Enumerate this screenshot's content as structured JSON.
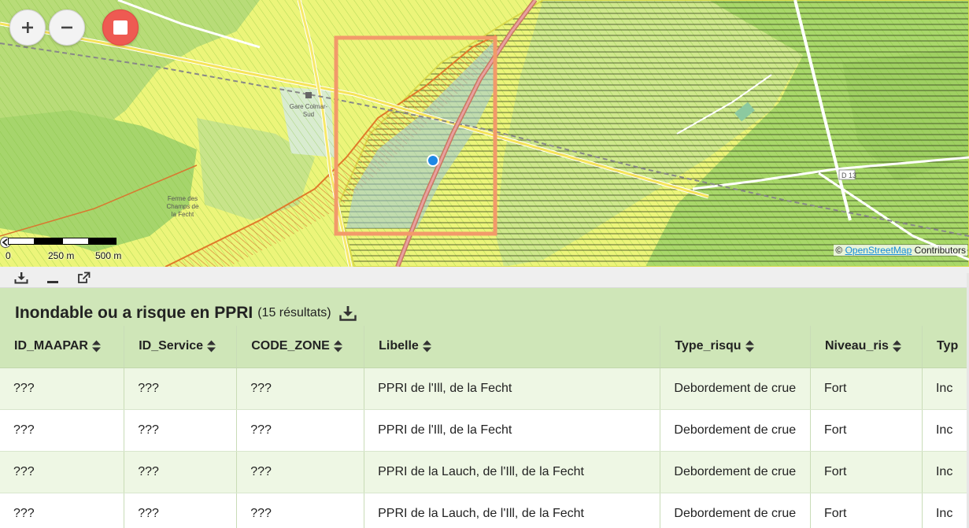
{
  "map": {
    "controls": {
      "zoom_in": "+",
      "zoom_out": "−"
    },
    "scale": {
      "labels": [
        "0",
        "250 m",
        "500 m"
      ]
    },
    "attribution": {
      "prefix": "©",
      "link": "OpenStreetMap",
      "suffix": "Contributors"
    },
    "place_labels": [
      "Gare Colmar-Sud",
      "Ferme des Champs de la Fecht",
      "D 13"
    ],
    "colors": {
      "base": "#e9f47a",
      "forest": "#a9d86a",
      "selection": "#f29a6a",
      "marker": "#1e88e5"
    }
  },
  "results": {
    "title": "Inondable ou a risque en PPRI",
    "count": "(15 résultats)",
    "columns": [
      "ID_MAAPAR",
      "ID_Service",
      "CODE_ZONE",
      "Libelle",
      "Type_risqu",
      "Niveau_ris",
      "Typ"
    ],
    "rows": [
      [
        "???",
        "???",
        "???",
        "PPRI de l'Ill, de la Fecht",
        "Debordement de crue",
        "Fort",
        "Inc"
      ],
      [
        "???",
        "???",
        "???",
        "PPRI de l'Ill, de la Fecht",
        "Debordement de crue",
        "Fort",
        "Inc"
      ],
      [
        "???",
        "???",
        "???",
        "PPRI de la Lauch, de l'Ill, de la Fecht",
        "Debordement de crue",
        "Fort",
        "Inc"
      ],
      [
        "???",
        "???",
        "???",
        "PPRI de la Lauch, de l'Ill, de la Fecht",
        "Debordement de crue",
        "Fort",
        "Inc"
      ]
    ]
  }
}
